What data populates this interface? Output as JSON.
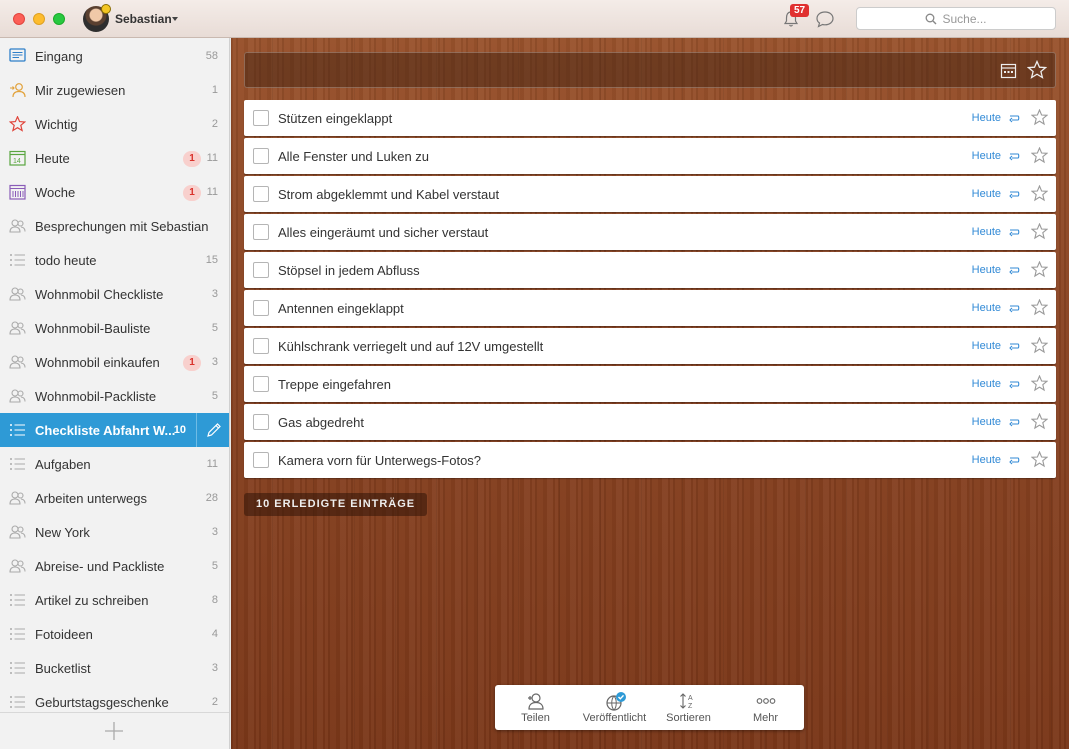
{
  "header": {
    "username": "Sebastian",
    "notification_count": "57",
    "search_placeholder": "Suche..."
  },
  "sidebar": {
    "items": [
      {
        "label": "Eingang",
        "count": "58",
        "icon": "inbox-icon",
        "overdue": ""
      },
      {
        "label": "Mir zugewiesen",
        "count": "1",
        "icon": "assigned-person-icon",
        "overdue": ""
      },
      {
        "label": "Wichtig",
        "count": "2",
        "icon": "star-icon",
        "overdue": ""
      },
      {
        "label": "Heute",
        "count": "11",
        "icon": "calendar-today-icon",
        "overdue": "1"
      },
      {
        "label": "Woche",
        "count": "11",
        "icon": "calendar-week-icon",
        "overdue": "1"
      },
      {
        "label": "Besprechungen mit Sebastian",
        "count": "",
        "icon": "shared-list-icon",
        "overdue": ""
      },
      {
        "label": "todo heute",
        "count": "15",
        "icon": "list-icon",
        "overdue": ""
      },
      {
        "label": "Wohnmobil Checkliste",
        "count": "3",
        "icon": "shared-list-icon",
        "overdue": ""
      },
      {
        "label": "Wohnmobil-Bauliste",
        "count": "5",
        "icon": "shared-list-icon",
        "overdue": ""
      },
      {
        "label": "Wohnmobil einkaufen",
        "count": "3",
        "icon": "shared-list-icon",
        "overdue": "1"
      },
      {
        "label": "Wohnmobil-Packliste",
        "count": "5",
        "icon": "shared-list-icon",
        "overdue": ""
      },
      {
        "label": "Checkliste Abfahrt W...",
        "count": "10",
        "icon": "list-icon",
        "overdue": ""
      },
      {
        "label": "Aufgaben",
        "count": "11",
        "icon": "list-icon",
        "overdue": ""
      },
      {
        "label": "Arbeiten unterwegs",
        "count": "28",
        "icon": "shared-list-icon",
        "overdue": ""
      },
      {
        "label": "New York",
        "count": "3",
        "icon": "shared-list-icon",
        "overdue": ""
      },
      {
        "label": "Abreise- und Packliste",
        "count": "5",
        "icon": "shared-list-icon",
        "overdue": ""
      },
      {
        "label": "Artikel zu schreiben",
        "count": "8",
        "icon": "list-icon",
        "overdue": ""
      },
      {
        "label": "Fotoideen",
        "count": "4",
        "icon": "list-icon",
        "overdue": ""
      },
      {
        "label": "Bucketlist",
        "count": "3",
        "icon": "list-icon",
        "overdue": ""
      },
      {
        "label": "Geburtstagsgeschenke",
        "count": "2",
        "icon": "list-icon",
        "overdue": ""
      }
    ],
    "active_index": 11
  },
  "main": {
    "tasks": [
      {
        "title": "Stützen eingeklappt",
        "due": "Heute"
      },
      {
        "title": "Alle Fenster und Luken zu",
        "due": "Heute"
      },
      {
        "title": "Strom abgeklemmt und Kabel verstaut",
        "due": "Heute"
      },
      {
        "title": "Alles eingeräumt und sicher verstaut",
        "due": "Heute"
      },
      {
        "title": "Stöpsel in jedem Abfluss",
        "due": "Heute"
      },
      {
        "title": "Antennen eingeklappt",
        "due": "Heute"
      },
      {
        "title": "Kühlschrank verriegelt und auf 12V umgestellt",
        "due": "Heute"
      },
      {
        "title": "Treppe eingefahren",
        "due": "Heute"
      },
      {
        "title": "Gas abgedreht",
        "due": "Heute"
      },
      {
        "title": "Kamera vorn für Unterwegs-Fotos?",
        "due": "Heute"
      }
    ],
    "completed_label": "10 ERLEDIGTE EINTRÄGE"
  },
  "toolbar": {
    "share": "Teilen",
    "published": "Veröffentlicht",
    "sort": "Sortieren",
    "more": "Mehr"
  },
  "colors": {
    "accent": "#2e9ad6",
    "due_text": "#328ad6",
    "overdue_badge": "#d9322b",
    "notification_badge": "#e0302f"
  }
}
